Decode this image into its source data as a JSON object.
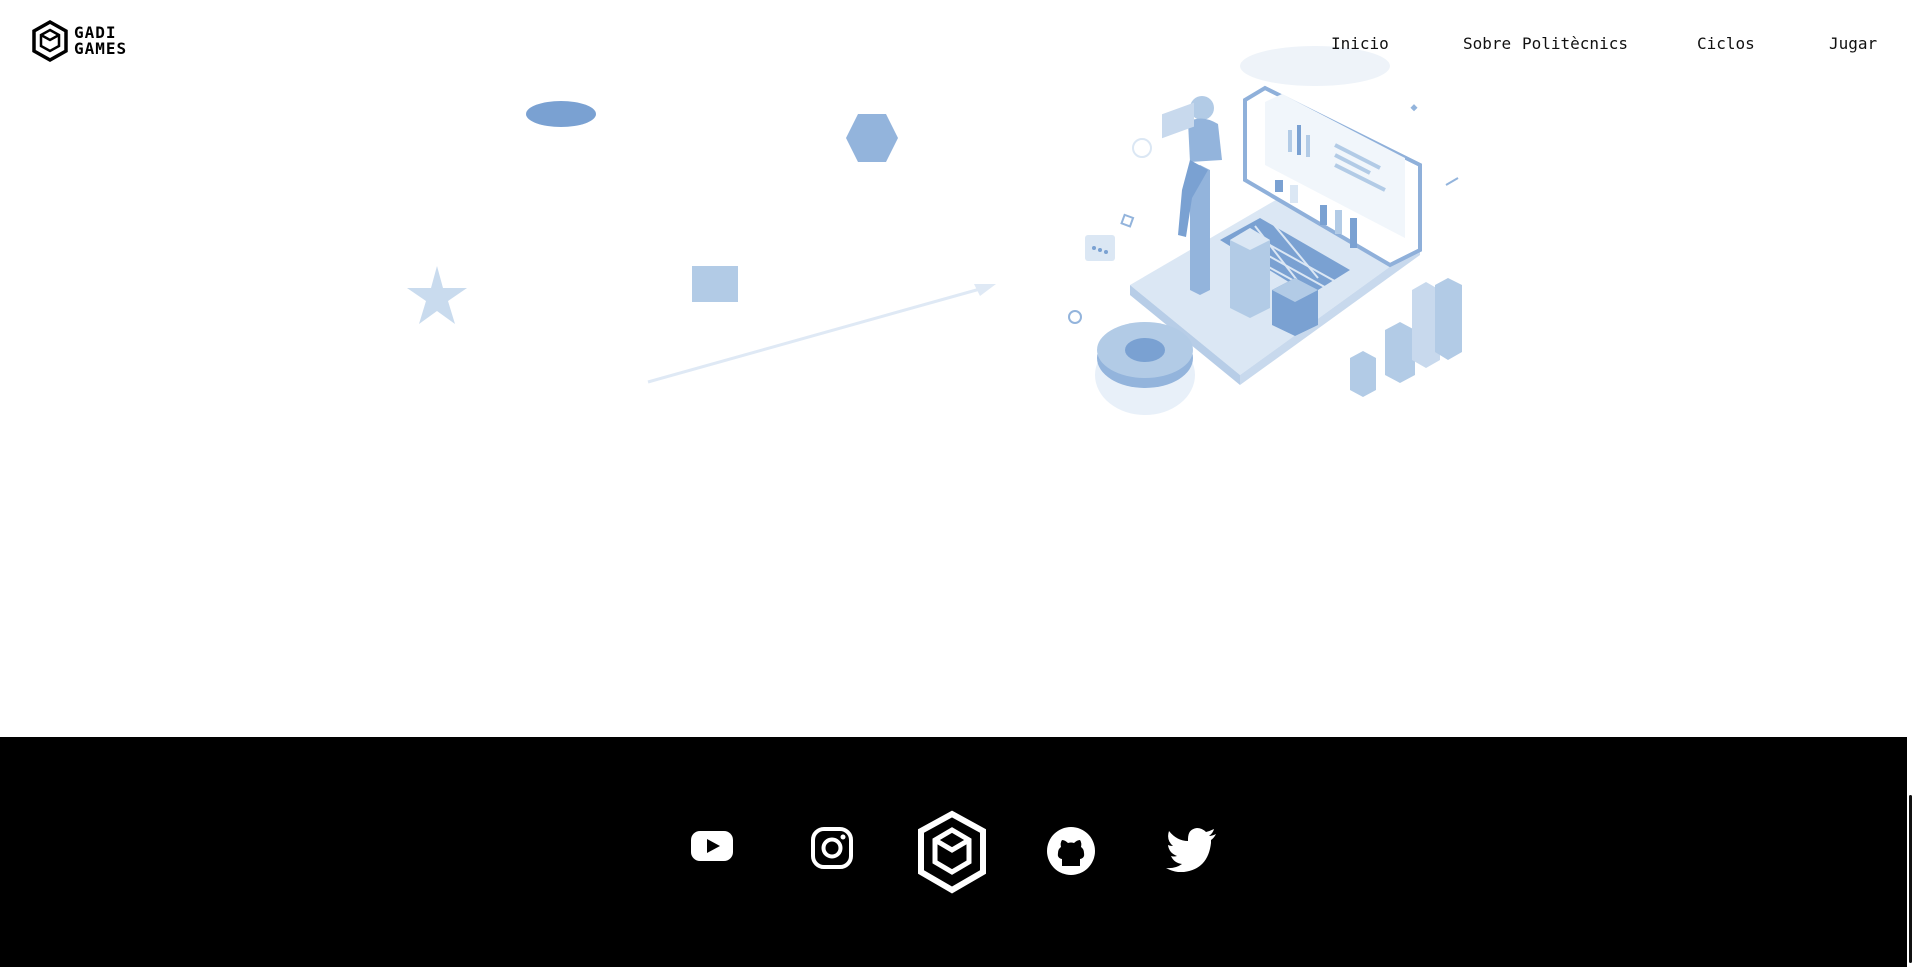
{
  "brand": {
    "line1": "GADI",
    "line2": "GAMES"
  },
  "nav": {
    "inicio": "Inicio",
    "sobre": "Sobre",
    "politecnics": "Politècnics",
    "ciclos": "Ciclos",
    "jugar": "Jugar"
  },
  "colors": {
    "accent": "#7aa1d2",
    "light_accent": "#b2cbe6",
    "pale": "#e8f0f9",
    "footer_bg": "#000000"
  },
  "footer": {
    "icons": [
      "youtube-icon",
      "instagram-icon",
      "gadi-games-logo-icon",
      "github-icon",
      "twitter-icon"
    ]
  }
}
